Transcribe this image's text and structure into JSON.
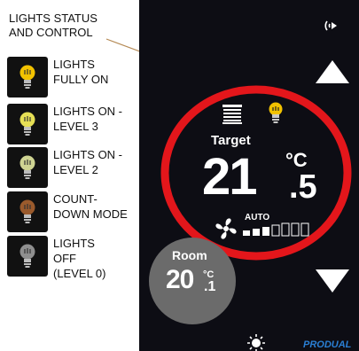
{
  "caption": "LIGHTS STATUS\nAND CONTROL",
  "legend": [
    {
      "label": "LIGHTS\nFULLY ON",
      "bulb_color": "#f2c200",
      "icon": "bulb-icon"
    },
    {
      "label": "LIGHTS ON -\nLEVEL 3",
      "bulb_color": "#e6df55",
      "icon": "bulb-icon"
    },
    {
      "label": "LIGHTS ON -\nLEVEL 2",
      "bulb_color": "#cfd492",
      "icon": "bulb-icon"
    },
    {
      "label": "COUNT-\nDOWN MODE",
      "bulb_color": "#9a5a2c",
      "icon": "bulb-icon"
    },
    {
      "label": "LIGHTS\nOFF\n(LEVEL 0)",
      "bulb_color": "#8f8f8f",
      "icon": "bulb-icon"
    }
  ],
  "thermostat": {
    "target_label": "Target",
    "target_whole": "21",
    "target_decimal": ".5",
    "unit": "°C",
    "fan_mode": "AUTO",
    "fan_level": 3,
    "fan_level_max": 7,
    "room_label": "Room",
    "room_whole": "20",
    "room_decimal": ".1",
    "room_unit": "°C",
    "brand": "PRODUAL",
    "ring_color": "#e3161b",
    "bulb_status_color": "#f2c200"
  }
}
